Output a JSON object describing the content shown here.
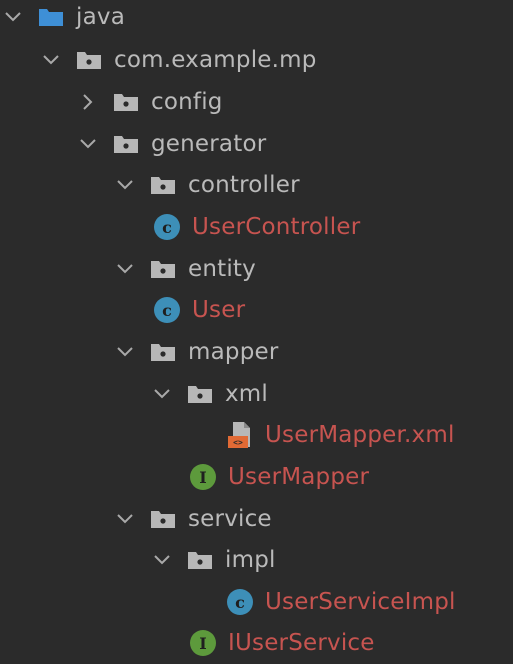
{
  "colors": {
    "background": "#2b2b2b",
    "package_text": "#bababa",
    "class_text_modified": "#c75450",
    "folder_blue": "#3e8fd6",
    "folder_grey": "#b7b7b7",
    "class_badge": "#3d8fb8",
    "interface_badge": "#5d9a3c",
    "xml_orange": "#e16a35"
  },
  "tree": {
    "nodes": [
      {
        "label": "java",
        "icon": "source-folder-icon",
        "expanded": true
      },
      {
        "label": "com.example.mp",
        "icon": "package-folder-icon",
        "expanded": true
      },
      {
        "label": "config",
        "icon": "package-folder-icon",
        "expanded": false
      },
      {
        "label": "generator",
        "icon": "package-folder-icon",
        "expanded": true
      },
      {
        "label": "controller",
        "icon": "package-folder-icon",
        "expanded": true
      },
      {
        "label": "UserController",
        "icon": "class-icon",
        "badge": "c"
      },
      {
        "label": "entity",
        "icon": "package-folder-icon",
        "expanded": true
      },
      {
        "label": "User",
        "icon": "class-icon",
        "badge": "c"
      },
      {
        "label": "mapper",
        "icon": "package-folder-icon",
        "expanded": true
      },
      {
        "label": "xml",
        "icon": "package-folder-icon",
        "expanded": true
      },
      {
        "label": "UserMapper.xml",
        "icon": "xml-file-icon"
      },
      {
        "label": "UserMapper",
        "icon": "interface-icon",
        "badge": "I"
      },
      {
        "label": "service",
        "icon": "package-folder-icon",
        "expanded": true
      },
      {
        "label": "impl",
        "icon": "package-folder-icon",
        "expanded": true
      },
      {
        "label": "UserServiceImpl",
        "icon": "class-icon",
        "badge": "c"
      },
      {
        "label": "IUserService",
        "icon": "interface-icon",
        "badge": "I"
      }
    ]
  }
}
